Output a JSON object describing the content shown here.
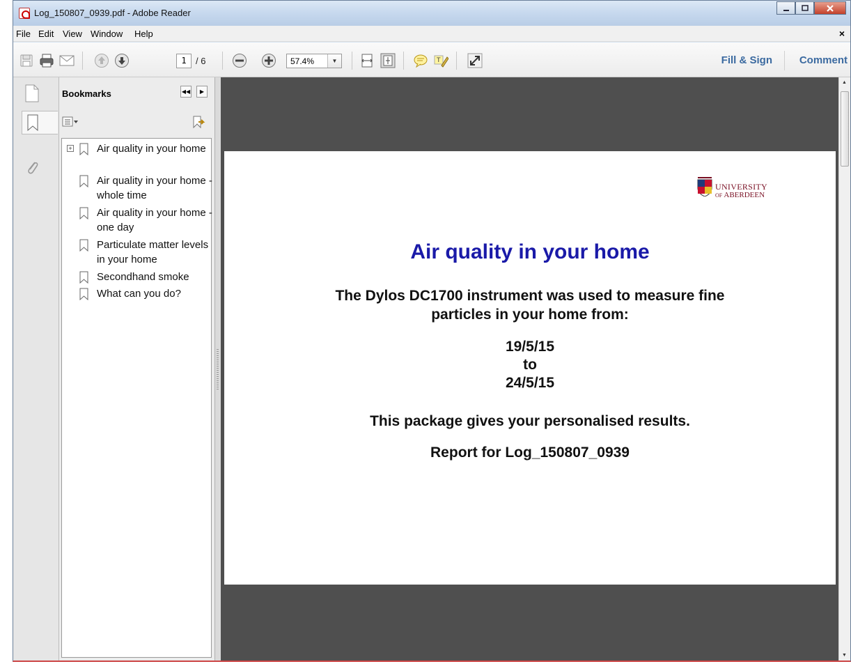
{
  "window": {
    "title": "Log_150807_0939.pdf - Adobe Reader"
  },
  "menu": {
    "file": "File",
    "edit": "Edit",
    "view": "View",
    "window": "Window",
    "help": "Help",
    "close_symbol": "×"
  },
  "toolbar": {
    "page_current": "1",
    "page_total": "/ 6",
    "zoom": "57.4%",
    "fill_sign": "Fill & Sign",
    "comment": "Comment",
    "icons": [
      "save-icon",
      "print-icon",
      "email-icon",
      "previous-page-icon",
      "next-page-icon",
      "zoom-out-icon",
      "zoom-in-icon",
      "fit-width-icon",
      "fit-page-icon",
      "sticky-note-icon",
      "highlight-icon",
      "full-screen-icon"
    ]
  },
  "bookmarks": {
    "title": "Bookmarks",
    "items": [
      {
        "label": "Air quality in your home",
        "expandable": true
      },
      {
        "label": "Air quality in your home - whole time"
      },
      {
        "label": "Air quality in your home - one day"
      },
      {
        "label": "Particulate matter levels in your home"
      },
      {
        "label": "Secondhand smoke"
      },
      {
        "label": "What can you do?"
      }
    ]
  },
  "document": {
    "logo": {
      "line1": "UNIVERSITY",
      "line2_of": "OF",
      "line2": "ABERDEEN"
    },
    "title": "Air quality in your home",
    "intro_line1": "The Dylos DC1700 instrument was used to measure fine",
    "intro_line2": "particles in your home from:",
    "date_from": "19/5/15",
    "to": "to",
    "date_to": "24/5/15",
    "package_line": "This package gives your personalised results.",
    "report_line": "Report for Log_150807_0939"
  },
  "colors": {
    "title_blue": "#1a1aa8",
    "toolbar_link": "#3b6aa0",
    "logo_red": "#7a1024",
    "doc_bg": "#4f4f4f"
  }
}
